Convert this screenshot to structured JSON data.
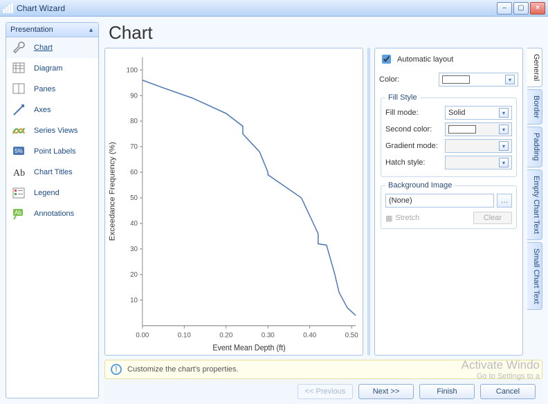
{
  "window": {
    "title": "Chart Wizard"
  },
  "sidebar": {
    "header": "Presentation",
    "items": [
      {
        "label": "Chart",
        "icon": "wrench"
      },
      {
        "label": "Diagram",
        "icon": "diagram"
      },
      {
        "label": "Panes",
        "icon": "panes"
      },
      {
        "label": "Axes",
        "icon": "axes"
      },
      {
        "label": "Series Views",
        "icon": "series"
      },
      {
        "label": "Point Labels",
        "icon": "pointlabel"
      },
      {
        "label": "Chart Titles",
        "icon": "titles"
      },
      {
        "label": "Legend",
        "icon": "legend"
      },
      {
        "label": "Annotations",
        "icon": "annotations"
      }
    ]
  },
  "main_title": "Chart",
  "properties": {
    "tabs": [
      "General",
      "Border",
      "Padding",
      "Empty Chart Text",
      "Small Chart Text"
    ],
    "active_tab": "General",
    "automatic_layout": {
      "label": "Automatic layout",
      "checked": true
    },
    "color": {
      "label": "Color:",
      "value": "#ffffff"
    },
    "fill_style": {
      "legend": "Fill Style",
      "fill_mode": {
        "label": "Fill mode:",
        "value": "Solid"
      },
      "second_color": {
        "label": "Second color:",
        "value": "#ffffff"
      },
      "gradient_mode": {
        "label": "Gradient mode:",
        "value": ""
      },
      "hatch_style": {
        "label": "Hatch style:",
        "value": ""
      }
    },
    "background_image": {
      "legend": "Background Image",
      "path": "(None)",
      "stretch_label": "Stretch",
      "clear_label": "Clear"
    }
  },
  "hint": "Customize the chart's properties.",
  "footer": {
    "previous": "<< Previous",
    "next": "Next >>",
    "finish": "Finish",
    "cancel": "Cancel"
  },
  "watermark": {
    "line1": "Activate Windo",
    "line2": "Go to Settings to a"
  },
  "chart_data": {
    "type": "line",
    "title": "",
    "xlabel": "Event Mean Depth (ft)",
    "ylabel": "Exceedance Frequency (%)",
    "xlim": [
      0.0,
      0.51
    ],
    "ylim": [
      0,
      105
    ],
    "x_ticks": [
      0.0,
      0.1,
      0.2,
      0.3,
      0.4,
      0.5
    ],
    "y_ticks": [
      10,
      20,
      30,
      40,
      50,
      60,
      70,
      80,
      90,
      100
    ],
    "series": [
      {
        "name": "Exceedance",
        "color": "#4b78b5",
        "x": [
          0.0,
          0.05,
          0.12,
          0.2,
          0.24,
          0.24,
          0.28,
          0.3,
          0.3,
          0.38,
          0.42,
          0.42,
          0.44,
          0.46,
          0.47,
          0.49,
          0.51
        ],
        "y": [
          96,
          93,
          89,
          83,
          78,
          75,
          68,
          60,
          59,
          50,
          36,
          32,
          31.5,
          20,
          13,
          7,
          4
        ]
      }
    ]
  }
}
